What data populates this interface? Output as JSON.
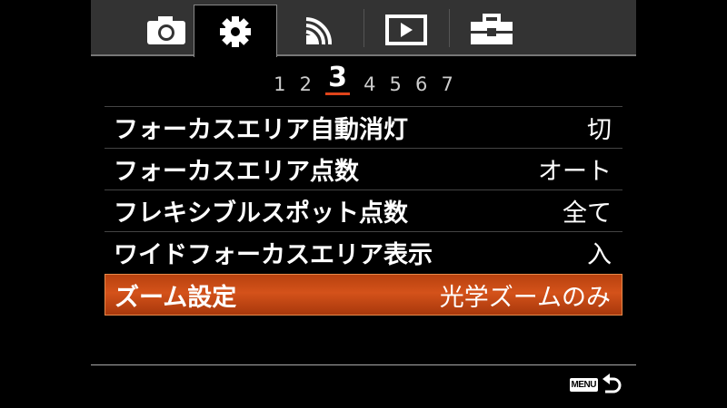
{
  "tabs": [
    {
      "icon": "camera-icon",
      "active": false
    },
    {
      "icon": "gear-icon",
      "active": true
    },
    {
      "icon": "wireless-icon",
      "active": false
    },
    {
      "icon": "playback-icon",
      "active": false
    },
    {
      "icon": "toolbox-icon",
      "active": false
    }
  ],
  "pages": [
    "1",
    "2",
    "3",
    "4",
    "5",
    "6",
    "7"
  ],
  "current_page": "3",
  "menu_items": [
    {
      "label": "フォーカスエリア自動消灯",
      "value": "切"
    },
    {
      "label": "フォーカスエリア点数",
      "value": "オート"
    },
    {
      "label": "フレキシブルスポット点数",
      "value": "全て"
    },
    {
      "label": "ワイドフォーカスエリア表示",
      "value": "入"
    },
    {
      "label": "ズーム設定",
      "value": "光学ズームのみ"
    }
  ],
  "selected_index": 4,
  "footer": {
    "menu_label": "MENU",
    "back_icon": "return-arrow-icon"
  },
  "colors": {
    "accent": "#d4521a",
    "tabbar": "#333333"
  }
}
